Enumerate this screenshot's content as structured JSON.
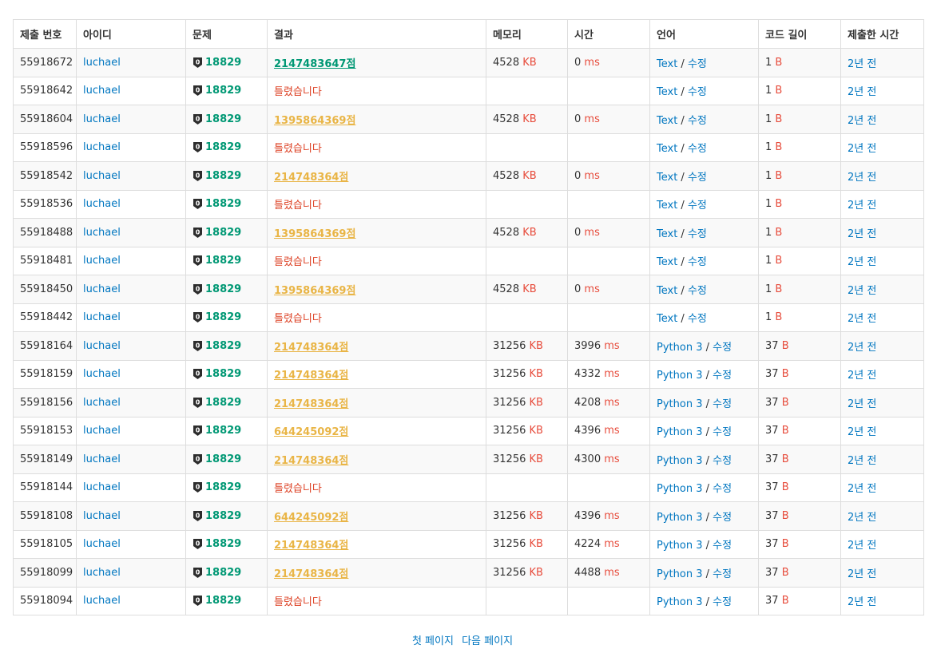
{
  "headers": [
    "제출 번호",
    "아이디",
    "문제",
    "결과",
    "메모리",
    "시간",
    "언어",
    "코드 길이",
    "제출한 시간"
  ],
  "units": {
    "memory": "KB",
    "time": "ms",
    "length": "B"
  },
  "edit_label": "수정",
  "colors": {
    "link": "#0076c0",
    "accepted": "#009874",
    "partial": "#e9b546",
    "wrong": "#dd4124",
    "unit": "#e74c3c"
  },
  "rows": [
    {
      "id": "55918672",
      "user": "luchael",
      "problem": "18829",
      "result": "2147483647점",
      "result_type": "ac",
      "memory": "4528",
      "time": "0",
      "lang": "Text",
      "length": "1",
      "submitted": "2년 전"
    },
    {
      "id": "55918642",
      "user": "luchael",
      "problem": "18829",
      "result": "틀렸습니다",
      "result_type": "wa",
      "memory": "",
      "time": "",
      "lang": "Text",
      "length": "1",
      "submitted": "2년 전"
    },
    {
      "id": "55918604",
      "user": "luchael",
      "problem": "18829",
      "result": "1395864369점",
      "result_type": "pac",
      "memory": "4528",
      "time": "0",
      "lang": "Text",
      "length": "1",
      "submitted": "2년 전"
    },
    {
      "id": "55918596",
      "user": "luchael",
      "problem": "18829",
      "result": "틀렸습니다",
      "result_type": "wa",
      "memory": "",
      "time": "",
      "lang": "Text",
      "length": "1",
      "submitted": "2년 전"
    },
    {
      "id": "55918542",
      "user": "luchael",
      "problem": "18829",
      "result": "214748364점",
      "result_type": "pac",
      "memory": "4528",
      "time": "0",
      "lang": "Text",
      "length": "1",
      "submitted": "2년 전"
    },
    {
      "id": "55918536",
      "user": "luchael",
      "problem": "18829",
      "result": "틀렸습니다",
      "result_type": "wa",
      "memory": "",
      "time": "",
      "lang": "Text",
      "length": "1",
      "submitted": "2년 전"
    },
    {
      "id": "55918488",
      "user": "luchael",
      "problem": "18829",
      "result": "1395864369점",
      "result_type": "pac",
      "memory": "4528",
      "time": "0",
      "lang": "Text",
      "length": "1",
      "submitted": "2년 전"
    },
    {
      "id": "55918481",
      "user": "luchael",
      "problem": "18829",
      "result": "틀렸습니다",
      "result_type": "wa",
      "memory": "",
      "time": "",
      "lang": "Text",
      "length": "1",
      "submitted": "2년 전"
    },
    {
      "id": "55918450",
      "user": "luchael",
      "problem": "18829",
      "result": "1395864369점",
      "result_type": "pac",
      "memory": "4528",
      "time": "0",
      "lang": "Text",
      "length": "1",
      "submitted": "2년 전"
    },
    {
      "id": "55918442",
      "user": "luchael",
      "problem": "18829",
      "result": "틀렸습니다",
      "result_type": "wa",
      "memory": "",
      "time": "",
      "lang": "Text",
      "length": "1",
      "submitted": "2년 전"
    },
    {
      "id": "55918164",
      "user": "luchael",
      "problem": "18829",
      "result": "214748364점",
      "result_type": "pac",
      "memory": "31256",
      "time": "3996",
      "lang": "Python 3",
      "length": "37",
      "submitted": "2년 전"
    },
    {
      "id": "55918159",
      "user": "luchael",
      "problem": "18829",
      "result": "214748364점",
      "result_type": "pac",
      "memory": "31256",
      "time": "4332",
      "lang": "Python 3",
      "length": "37",
      "submitted": "2년 전"
    },
    {
      "id": "55918156",
      "user": "luchael",
      "problem": "18829",
      "result": "214748364점",
      "result_type": "pac",
      "memory": "31256",
      "time": "4208",
      "lang": "Python 3",
      "length": "37",
      "submitted": "2년 전"
    },
    {
      "id": "55918153",
      "user": "luchael",
      "problem": "18829",
      "result": "644245092점",
      "result_type": "pac",
      "memory": "31256",
      "time": "4396",
      "lang": "Python 3",
      "length": "37",
      "submitted": "2년 전"
    },
    {
      "id": "55918149",
      "user": "luchael",
      "problem": "18829",
      "result": "214748364점",
      "result_type": "pac",
      "memory": "31256",
      "time": "4300",
      "lang": "Python 3",
      "length": "37",
      "submitted": "2년 전"
    },
    {
      "id": "55918144",
      "user": "luchael",
      "problem": "18829",
      "result": "틀렸습니다",
      "result_type": "wa",
      "memory": "",
      "time": "",
      "lang": "Python 3",
      "length": "37",
      "submitted": "2년 전"
    },
    {
      "id": "55918108",
      "user": "luchael",
      "problem": "18829",
      "result": "644245092점",
      "result_type": "pac",
      "memory": "31256",
      "time": "4396",
      "lang": "Python 3",
      "length": "37",
      "submitted": "2년 전"
    },
    {
      "id": "55918105",
      "user": "luchael",
      "problem": "18829",
      "result": "214748364점",
      "result_type": "pac",
      "memory": "31256",
      "time": "4224",
      "lang": "Python 3",
      "length": "37",
      "submitted": "2년 전"
    },
    {
      "id": "55918099",
      "user": "luchael",
      "problem": "18829",
      "result": "214748364점",
      "result_type": "pac",
      "memory": "31256",
      "time": "4488",
      "lang": "Python 3",
      "length": "37",
      "submitted": "2년 전"
    },
    {
      "id": "55918094",
      "user": "luchael",
      "problem": "18829",
      "result": "틀렸습니다",
      "result_type": "wa",
      "memory": "",
      "time": "",
      "lang": "Python 3",
      "length": "37",
      "submitted": "2년 전"
    }
  ],
  "pagination": {
    "first": "첫 페이지",
    "next": "다음 페이지"
  }
}
